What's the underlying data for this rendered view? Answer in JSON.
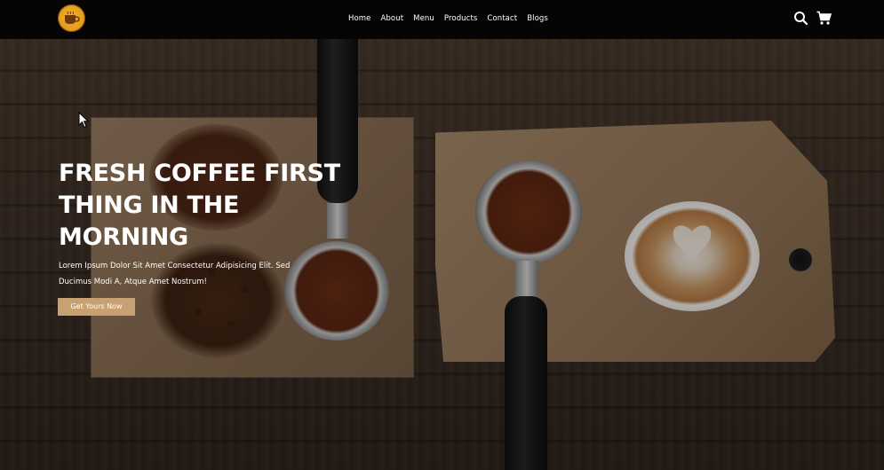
{
  "navbar": {
    "logo_icon": "coffee-cup-logo-icon",
    "links": [
      "Home",
      "About",
      "Menu",
      "Products",
      "Contact",
      "Blogs"
    ],
    "search_icon": "search-icon",
    "cart_icon": "cart-icon"
  },
  "hero": {
    "title": "FRESH COFFEE FIRST THING IN THE MORNING",
    "subtitle": "Lorem Ipsum Dolor Sit Amet Consectetur Adipisicing Elit. Sed Ducimus Modi A, Atque Amet Nostrum!",
    "cta_label": "Get Yours Now",
    "cta_color": "#c9a071"
  },
  "colors": {
    "navbar_bg": "#050505",
    "logo_accent": "#f5b02e",
    "text": "#ffffff"
  }
}
